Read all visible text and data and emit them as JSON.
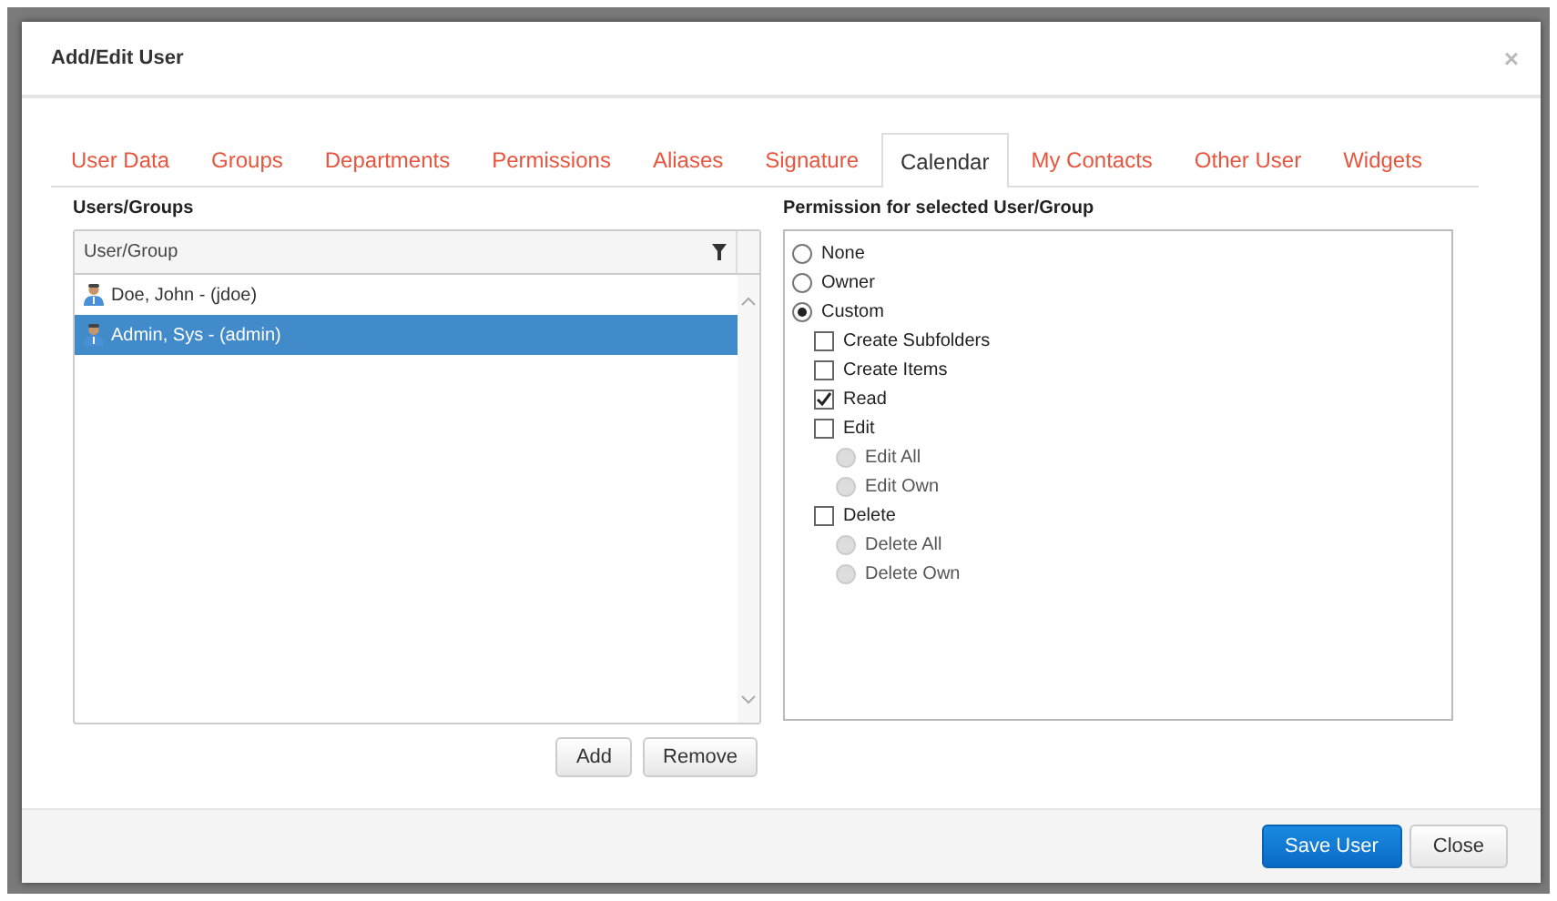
{
  "dialog": {
    "title": "Add/Edit User",
    "close": "×"
  },
  "tabs": [
    {
      "label": "User Data",
      "selected": false
    },
    {
      "label": "Groups",
      "selected": false
    },
    {
      "label": "Departments",
      "selected": false
    },
    {
      "label": "Permissions",
      "selected": false
    },
    {
      "label": "Aliases",
      "selected": false
    },
    {
      "label": "Signature",
      "selected": false
    },
    {
      "label": "Calendar",
      "selected": true
    },
    {
      "label": "My Contacts",
      "selected": false
    },
    {
      "label": "Other User",
      "selected": false
    },
    {
      "label": "Widgets",
      "selected": false
    }
  ],
  "users_panel": {
    "title": "Users/Groups",
    "column": "User/Group",
    "rows": [
      {
        "name": "Doe, John - (jdoe)",
        "selected": false
      },
      {
        "name": "Admin, Sys - (admin)",
        "selected": true
      }
    ],
    "buttons": [
      "Add",
      "Remove"
    ]
  },
  "permission_panel": {
    "title": "Permission for selected User/Group",
    "options": [
      {
        "kind": "radio",
        "label": "None",
        "selected": false,
        "disabled": false
      },
      {
        "kind": "radio",
        "label": "Owner",
        "selected": false,
        "disabled": false
      },
      {
        "kind": "radio",
        "label": "Custom",
        "selected": true,
        "disabled": false,
        "children": [
          {
            "kind": "checkbox",
            "label": "Create Subfolders",
            "checked": false
          },
          {
            "kind": "checkbox",
            "label": "Create Items",
            "checked": false
          },
          {
            "kind": "checkbox",
            "label": "Read",
            "checked": true
          },
          {
            "kind": "checkbox",
            "label": "Edit",
            "checked": false,
            "children": [
              {
                "kind": "radio",
                "label": "Edit All",
                "selected": false,
                "disabled": true
              },
              {
                "kind": "radio",
                "label": "Edit Own",
                "selected": false,
                "disabled": true
              }
            ]
          },
          {
            "kind": "checkbox",
            "label": "Delete",
            "checked": false,
            "children": [
              {
                "kind": "radio",
                "label": "Delete All",
                "selected": false,
                "disabled": true
              },
              {
                "kind": "radio",
                "label": "Delete Own",
                "selected": false,
                "disabled": true
              }
            ]
          }
        ]
      }
    ]
  },
  "footer": {
    "buttons": [
      {
        "label": "Save User",
        "kind": "primary"
      },
      {
        "label": "Close",
        "kind": "default"
      }
    ]
  }
}
